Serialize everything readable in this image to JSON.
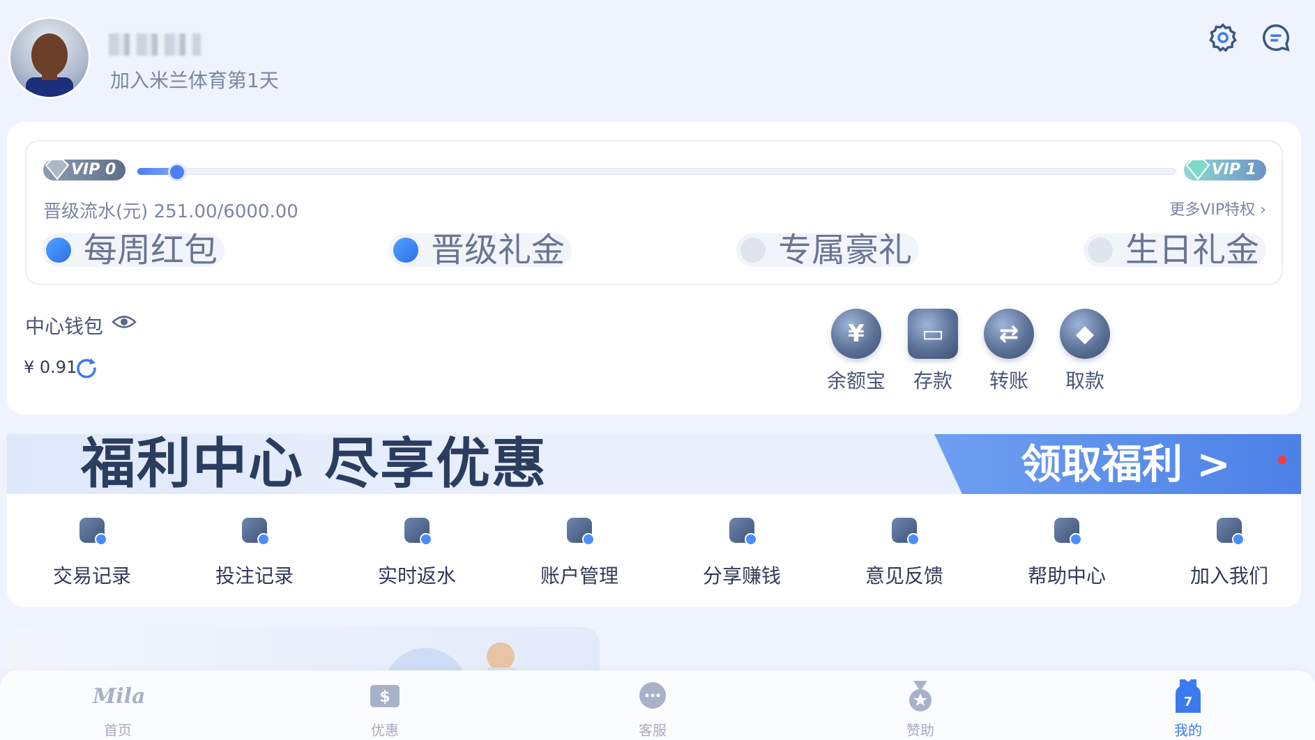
{
  "header": {
    "join_text": "加入米兰体育第1天",
    "icons": [
      "settings-icon",
      "message-icon"
    ]
  },
  "vip": {
    "current_level": "VIP 0",
    "next_level": "VIP 1",
    "upgrade_label": "晋级流水(元) 251.00/6000.00",
    "progress_fraction": 0.042,
    "more_link": "更多VIP特权",
    "perks": [
      {
        "label": "每周红包",
        "unlocked": true
      },
      {
        "label": "晋级礼金",
        "unlocked": true
      },
      {
        "label": "专属豪礼",
        "unlocked": false
      },
      {
        "label": "生日礼金",
        "unlocked": false
      }
    ],
    "colors": {
      "unlocked": "#2f6ee8",
      "locked": "#dfe4ee"
    }
  },
  "wallet": {
    "label": "中心钱包",
    "amount": "¥ 0.91",
    "actions": [
      {
        "label": "余额宝",
        "icon": "yen-coin-icon",
        "glyph": "¥"
      },
      {
        "label": "存款",
        "icon": "wallet-icon",
        "glyph": "▭"
      },
      {
        "label": "转账",
        "icon": "transfer-icon",
        "glyph": "⇄"
      },
      {
        "label": "取款",
        "icon": "withdraw-icon",
        "glyph": "◆"
      }
    ]
  },
  "banner": {
    "title": "福利中心 尽享优惠",
    "cta": "领取福利 >"
  },
  "menu": {
    "items": [
      {
        "label": "交易记录",
        "icon": "transaction-record-icon"
      },
      {
        "label": "投注记录",
        "icon": "bet-record-icon"
      },
      {
        "label": "实时返水",
        "icon": "rebate-icon"
      },
      {
        "label": "账户管理",
        "icon": "account-icon"
      },
      {
        "label": "分享赚钱",
        "icon": "share-icon"
      },
      {
        "label": "意见反馈",
        "icon": "feedback-icon"
      },
      {
        "label": "帮助中心",
        "icon": "help-icon"
      },
      {
        "label": "加入我们",
        "icon": "join-us-icon"
      }
    ]
  },
  "bottom_nav": {
    "items": [
      {
        "label": "首页",
        "icon": "milan-logo-icon"
      },
      {
        "label": "优惠",
        "icon": "coupon-icon"
      },
      {
        "label": "客服",
        "icon": "chat-icon"
      },
      {
        "label": "赞助",
        "icon": "medal-icon"
      },
      {
        "label": "我的",
        "icon": "jersey-icon",
        "active": true
      }
    ],
    "accent": "#3b7bef"
  }
}
